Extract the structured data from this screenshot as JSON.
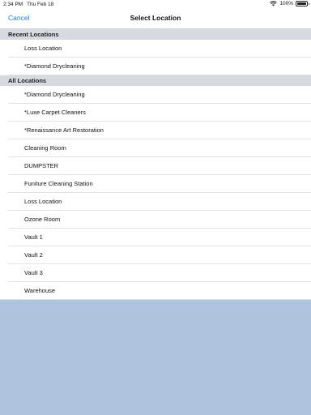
{
  "status_bar": {
    "time": "2:34 PM",
    "date": "Thu Feb 18",
    "battery": "100%",
    "icons": [
      "wifi-icon",
      "battery-icon"
    ]
  },
  "nav_bar": {
    "cancel_label": "Cancel",
    "title": "Select Location",
    "accent_color": "#1f7ae0"
  },
  "sections": {
    "recent": {
      "header": "Recent Locations",
      "items": [
        "Loss Location",
        "*Diamond Drycleaning"
      ]
    },
    "all": {
      "header": "All Locations",
      "items": [
        "*Diamond Drycleaning",
        "*Luxe Carpet Cleaners",
        "*Renaissance Art Restoration",
        "Cleaning Room",
        "DUMPSTER",
        "Funiture Cleaning Station",
        "Loss Location",
        "Ozone Room",
        "Vault 1",
        "Vault 2",
        "Vault 3",
        "Warehouse"
      ]
    }
  },
  "colors": {
    "background": "#aec3dc",
    "section_header_bg": "#d6d9e0"
  }
}
